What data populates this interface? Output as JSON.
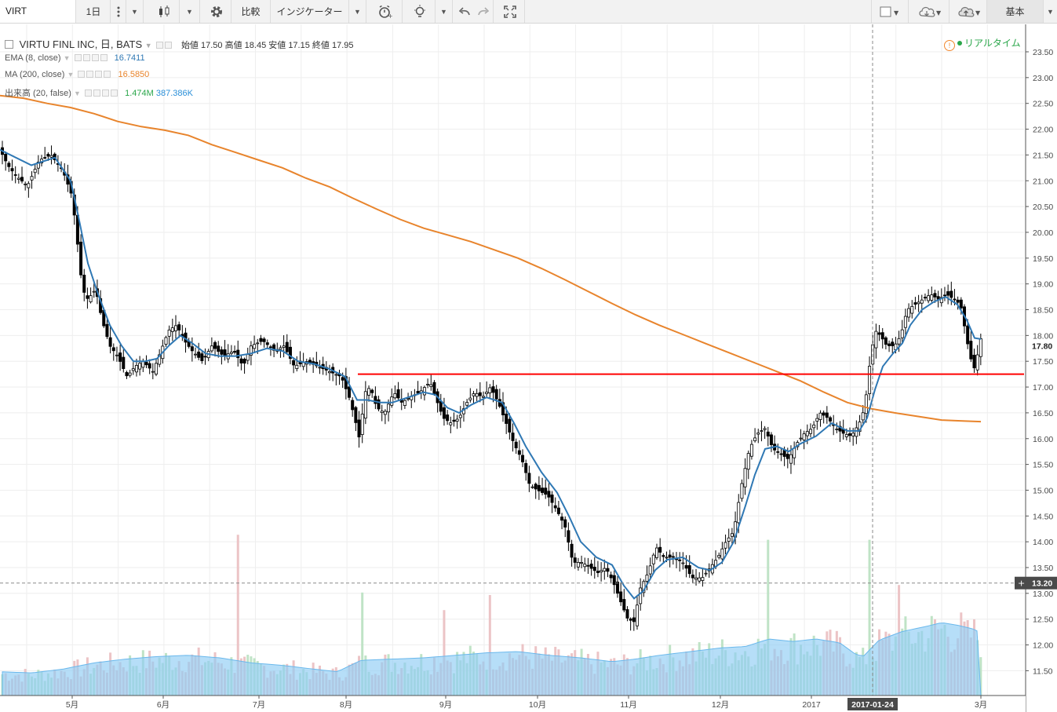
{
  "toolbar": {
    "symbol": "VIRT",
    "interval": "1日",
    "compare_label": "比較",
    "indicators_label": "インジケーター",
    "layout_label": "基本"
  },
  "legend": {
    "main": {
      "name": "VIRTU FINL INC, 日, BATS",
      "open_label": "始値",
      "open": "17.50",
      "high_label": "高値",
      "high": "18.45",
      "low_label": "安値",
      "low": "17.15",
      "close_label": "終値",
      "close": "17.95"
    },
    "ema": {
      "name": "EMA (8, close)",
      "value": "16.7411",
      "color": "#2f78b4"
    },
    "ma": {
      "name": "MA (200, close)",
      "value": "16.5850",
      "color": "#e8842c"
    },
    "volume": {
      "name": "出来高 (20, false)",
      "value1": "1.474M",
      "value2": "387.386K",
      "color1": "#2aa64a",
      "color2": "#2a8fd8"
    },
    "realtime": "リアルタイム"
  },
  "chart_data": {
    "type": "candlestick",
    "x_tick_labels": [
      "5月",
      "6月",
      "7月",
      "8月",
      "9月",
      "10月",
      "11月",
      "12月",
      "2017",
      "3月"
    ],
    "crosshair_date_label": "2017-01-24",
    "y_tick_labels": [
      "11.50",
      "12.00",
      "12.50",
      "13.00",
      "13.50",
      "14.00",
      "14.50",
      "15.00",
      "15.50",
      "16.00",
      "16.50",
      "17.00",
      "17.50",
      "18.00",
      "18.50",
      "19.00",
      "19.50",
      "20.00",
      "20.50",
      "21.00",
      "21.50",
      "22.00",
      "22.50",
      "23.00",
      "23.50"
    ],
    "ylim": [
      11.0,
      23.8
    ],
    "last_price_label": "17.80",
    "crosshair_price_label": "13.20",
    "horizontal_line": {
      "price": 17.25,
      "color": "#ff0000"
    },
    "colors": {
      "up_body": "#ffffff",
      "down_body": "#000000",
      "wick": "#000000",
      "ema": "#2f78b4",
      "ma": "#e8842c",
      "vol_up": "#bfe3c6",
      "vol_down": "#ecc4c6",
      "vol_ma_fill": "#8fcdf4"
    },
    "price_path": [
      [
        0,
        21.6
      ],
      [
        10,
        21.3
      ],
      [
        20,
        21.1
      ],
      [
        35,
        20.9
      ],
      [
        50,
        21.4
      ],
      [
        65,
        21.5
      ],
      [
        80,
        21.2
      ],
      [
        92,
        20.7
      ],
      [
        98,
        19.9
      ],
      [
        105,
        18.9
      ],
      [
        112,
        18.7
      ],
      [
        122,
        18.9
      ],
      [
        130,
        18.3
      ],
      [
        140,
        17.8
      ],
      [
        150,
        17.6
      ],
      [
        162,
        17.2
      ],
      [
        172,
        17.4
      ],
      [
        182,
        17.5
      ],
      [
        195,
        17.3
      ],
      [
        205,
        17.7
      ],
      [
        215,
        18.1
      ],
      [
        225,
        18.2
      ],
      [
        235,
        17.9
      ],
      [
        245,
        17.7
      ],
      [
        258,
        17.5
      ],
      [
        270,
        17.8
      ],
      [
        285,
        17.6
      ],
      [
        298,
        17.7
      ],
      [
        310,
        17.4
      ],
      [
        320,
        17.8
      ],
      [
        335,
        17.9
      ],
      [
        350,
        17.7
      ],
      [
        362,
        17.8
      ],
      [
        375,
        17.4
      ],
      [
        390,
        17.5
      ],
      [
        405,
        17.4
      ],
      [
        420,
        17.3
      ],
      [
        435,
        17.2
      ],
      [
        445,
        16.8
      ],
      [
        452,
        16.4
      ],
      [
        458,
        16.0
      ],
      [
        465,
        16.9
      ],
      [
        472,
        17.0
      ],
      [
        480,
        16.6
      ],
      [
        490,
        16.5
      ],
      [
        502,
        16.9
      ],
      [
        512,
        16.7
      ],
      [
        522,
        16.8
      ],
      [
        535,
        16.9
      ],
      [
        548,
        17.1
      ],
      [
        555,
        16.8
      ],
      [
        565,
        16.4
      ],
      [
        575,
        16.3
      ],
      [
        585,
        16.4
      ],
      [
        595,
        16.7
      ],
      [
        605,
        16.9
      ],
      [
        615,
        16.8
      ],
      [
        625,
        17.0
      ],
      [
        635,
        16.7
      ],
      [
        645,
        16.3
      ],
      [
        655,
        15.9
      ],
      [
        665,
        15.6
      ],
      [
        675,
        15.1
      ],
      [
        685,
        15.0
      ],
      [
        698,
        14.9
      ],
      [
        710,
        14.6
      ],
      [
        720,
        14.3
      ],
      [
        730,
        13.6
      ],
      [
        742,
        13.6
      ],
      [
        752,
        13.5
      ],
      [
        762,
        13.4
      ],
      [
        772,
        13.5
      ],
      [
        782,
        13.2
      ],
      [
        792,
        12.8
      ],
      [
        800,
        12.5
      ],
      [
        808,
        12.45
      ],
      [
        816,
        13.1
      ],
      [
        826,
        13.4
      ],
      [
        836,
        13.9
      ],
      [
        846,
        13.7
      ],
      [
        858,
        13.7
      ],
      [
        870,
        13.6
      ],
      [
        882,
        13.3
      ],
      [
        895,
        13.3
      ],
      [
        905,
        13.5
      ],
      [
        915,
        13.7
      ],
      [
        925,
        14.0
      ],
      [
        935,
        14.2
      ],
      [
        945,
        15.1
      ],
      [
        955,
        15.8
      ],
      [
        965,
        16.1
      ],
      [
        975,
        16.2
      ],
      [
        985,
        15.8
      ],
      [
        995,
        15.7
      ],
      [
        1005,
        15.6
      ],
      [
        1015,
        15.9
      ],
      [
        1025,
        16.1
      ],
      [
        1035,
        16.2
      ],
      [
        1045,
        16.5
      ],
      [
        1055,
        16.4
      ],
      [
        1065,
        16.2
      ],
      [
        1075,
        16.1
      ],
      [
        1085,
        16.05
      ],
      [
        1095,
        16.3
      ],
      [
        1102,
        16.6
      ],
      [
        1108,
        17.4
      ],
      [
        1115,
        18.1
      ],
      [
        1122,
        18.0
      ],
      [
        1130,
        17.8
      ],
      [
        1140,
        17.8
      ],
      [
        1148,
        18.0
      ],
      [
        1156,
        18.5
      ],
      [
        1166,
        18.6
      ],
      [
        1176,
        18.7
      ],
      [
        1186,
        18.8
      ],
      [
        1196,
        18.7
      ],
      [
        1206,
        18.8
      ],
      [
        1216,
        18.7
      ],
      [
        1224,
        18.6
      ],
      [
        1230,
        18.1
      ],
      [
        1236,
        17.6
      ],
      [
        1242,
        17.35
      ],
      [
        1250,
        17.95
      ]
    ],
    "ema_path": [
      [
        0,
        21.6
      ],
      [
        40,
        21.3
      ],
      [
        70,
        21.45
      ],
      [
        90,
        21.0
      ],
      [
        100,
        20.3
      ],
      [
        112,
        19.4
      ],
      [
        125,
        18.8
      ],
      [
        140,
        18.2
      ],
      [
        155,
        17.8
      ],
      [
        170,
        17.5
      ],
      [
        185,
        17.5
      ],
      [
        200,
        17.55
      ],
      [
        215,
        17.8
      ],
      [
        230,
        18.0
      ],
      [
        245,
        17.85
      ],
      [
        262,
        17.65
      ],
      [
        280,
        17.6
      ],
      [
        300,
        17.6
      ],
      [
        320,
        17.65
      ],
      [
        340,
        17.75
      ],
      [
        360,
        17.7
      ],
      [
        380,
        17.5
      ],
      [
        400,
        17.45
      ],
      [
        420,
        17.35
      ],
      [
        440,
        17.2
      ],
      [
        455,
        16.75
      ],
      [
        468,
        16.75
      ],
      [
        485,
        16.7
      ],
      [
        500,
        16.7
      ],
      [
        520,
        16.8
      ],
      [
        540,
        16.9
      ],
      [
        555,
        16.85
      ],
      [
        570,
        16.6
      ],
      [
        585,
        16.5
      ],
      [
        600,
        16.65
      ],
      [
        620,
        16.8
      ],
      [
        640,
        16.7
      ],
      [
        655,
        16.3
      ],
      [
        670,
        15.85
      ],
      [
        690,
        15.35
      ],
      [
        710,
        14.95
      ],
      [
        725,
        14.5
      ],
      [
        740,
        14.0
      ],
      [
        760,
        13.7
      ],
      [
        780,
        13.55
      ],
      [
        795,
        13.15
      ],
      [
        808,
        12.9
      ],
      [
        820,
        13.05
      ],
      [
        835,
        13.45
      ],
      [
        850,
        13.65
      ],
      [
        870,
        13.7
      ],
      [
        890,
        13.5
      ],
      [
        905,
        13.45
      ],
      [
        920,
        13.6
      ],
      [
        935,
        14.0
      ],
      [
        950,
        14.7
      ],
      [
        962,
        15.3
      ],
      [
        975,
        15.8
      ],
      [
        990,
        15.85
      ],
      [
        1005,
        15.75
      ],
      [
        1020,
        15.9
      ],
      [
        1040,
        16.05
      ],
      [
        1060,
        16.3
      ],
      [
        1080,
        16.15
      ],
      [
        1095,
        16.15
      ],
      [
        1105,
        16.4
      ],
      [
        1115,
        16.95
      ],
      [
        1125,
        17.4
      ],
      [
        1138,
        17.65
      ],
      [
        1150,
        17.85
      ],
      [
        1160,
        18.2
      ],
      [
        1175,
        18.5
      ],
      [
        1190,
        18.65
      ],
      [
        1205,
        18.75
      ],
      [
        1220,
        18.6
      ],
      [
        1232,
        18.3
      ],
      [
        1242,
        17.95
      ],
      [
        1250,
        17.93
      ]
    ],
    "ma_path": [
      [
        0,
        22.65
      ],
      [
        30,
        22.6
      ],
      [
        60,
        22.5
      ],
      [
        90,
        22.42
      ],
      [
        120,
        22.3
      ],
      [
        150,
        22.15
      ],
      [
        180,
        22.05
      ],
      [
        210,
        21.98
      ],
      [
        240,
        21.88
      ],
      [
        270,
        21.7
      ],
      [
        300,
        21.55
      ],
      [
        330,
        21.4
      ],
      [
        360,
        21.25
      ],
      [
        390,
        21.05
      ],
      [
        420,
        20.88
      ],
      [
        450,
        20.66
      ],
      [
        480,
        20.45
      ],
      [
        510,
        20.25
      ],
      [
        540,
        20.08
      ],
      [
        570,
        19.95
      ],
      [
        600,
        19.82
      ],
      [
        630,
        19.66
      ],
      [
        660,
        19.5
      ],
      [
        690,
        19.3
      ],
      [
        720,
        19.08
      ],
      [
        750,
        18.85
      ],
      [
        780,
        18.62
      ],
      [
        810,
        18.4
      ],
      [
        840,
        18.2
      ],
      [
        870,
        18.02
      ],
      [
        900,
        17.84
      ],
      [
        930,
        17.66
      ],
      [
        960,
        17.48
      ],
      [
        990,
        17.3
      ],
      [
        1020,
        17.12
      ],
      [
        1050,
        16.9
      ],
      [
        1080,
        16.7
      ],
      [
        1110,
        16.58
      ],
      [
        1140,
        16.5
      ],
      [
        1170,
        16.43
      ],
      [
        1200,
        16.36
      ],
      [
        1230,
        16.34
      ],
      [
        1250,
        16.33
      ]
    ],
    "volume_profile": [
      [
        0,
        0.95
      ],
      [
        40,
        0.9
      ],
      [
        80,
        1.05
      ],
      [
        120,
        1.3
      ],
      [
        160,
        1.45
      ],
      [
        200,
        1.55
      ],
      [
        240,
        1.6
      ],
      [
        280,
        1.5
      ],
      [
        320,
        1.3
      ],
      [
        360,
        1.2
      ],
      [
        400,
        1.05
      ],
      [
        430,
        0.95
      ],
      [
        460,
        1.4
      ],
      [
        500,
        1.45
      ],
      [
        540,
        1.5
      ],
      [
        580,
        1.6
      ],
      [
        620,
        1.7
      ],
      [
        660,
        1.75
      ],
      [
        700,
        1.6
      ],
      [
        740,
        1.5
      ],
      [
        780,
        1.35
      ],
      [
        810,
        1.45
      ],
      [
        840,
        1.6
      ],
      [
        880,
        1.75
      ],
      [
        920,
        1.9
      ],
      [
        950,
        1.95
      ],
      [
        980,
        2.25
      ],
      [
        1010,
        2.15
      ],
      [
        1040,
        2.25
      ],
      [
        1070,
        2.1
      ],
      [
        1090,
        1.65
      ],
      [
        1100,
        1.55
      ],
      [
        1120,
        2.2
      ],
      [
        1150,
        2.55
      ],
      [
        1180,
        2.75
      ],
      [
        1200,
        2.9
      ],
      [
        1220,
        2.8
      ],
      [
        1240,
        2.65
      ],
      [
        1250,
        2.5
      ]
    ],
    "volume_spikes": [
      [
        305,
        6.4,
        "d"
      ],
      [
        463,
        4.1,
        "u"
      ],
      [
        566,
        3.4,
        "d"
      ],
      [
        625,
        4.0,
        "d"
      ],
      [
        978,
        6.2,
        "u"
      ],
      [
        1110,
        6.2,
        "u"
      ],
      [
        1145,
        4.4,
        "d"
      ],
      [
        1235,
        3.0,
        "d"
      ]
    ]
  }
}
